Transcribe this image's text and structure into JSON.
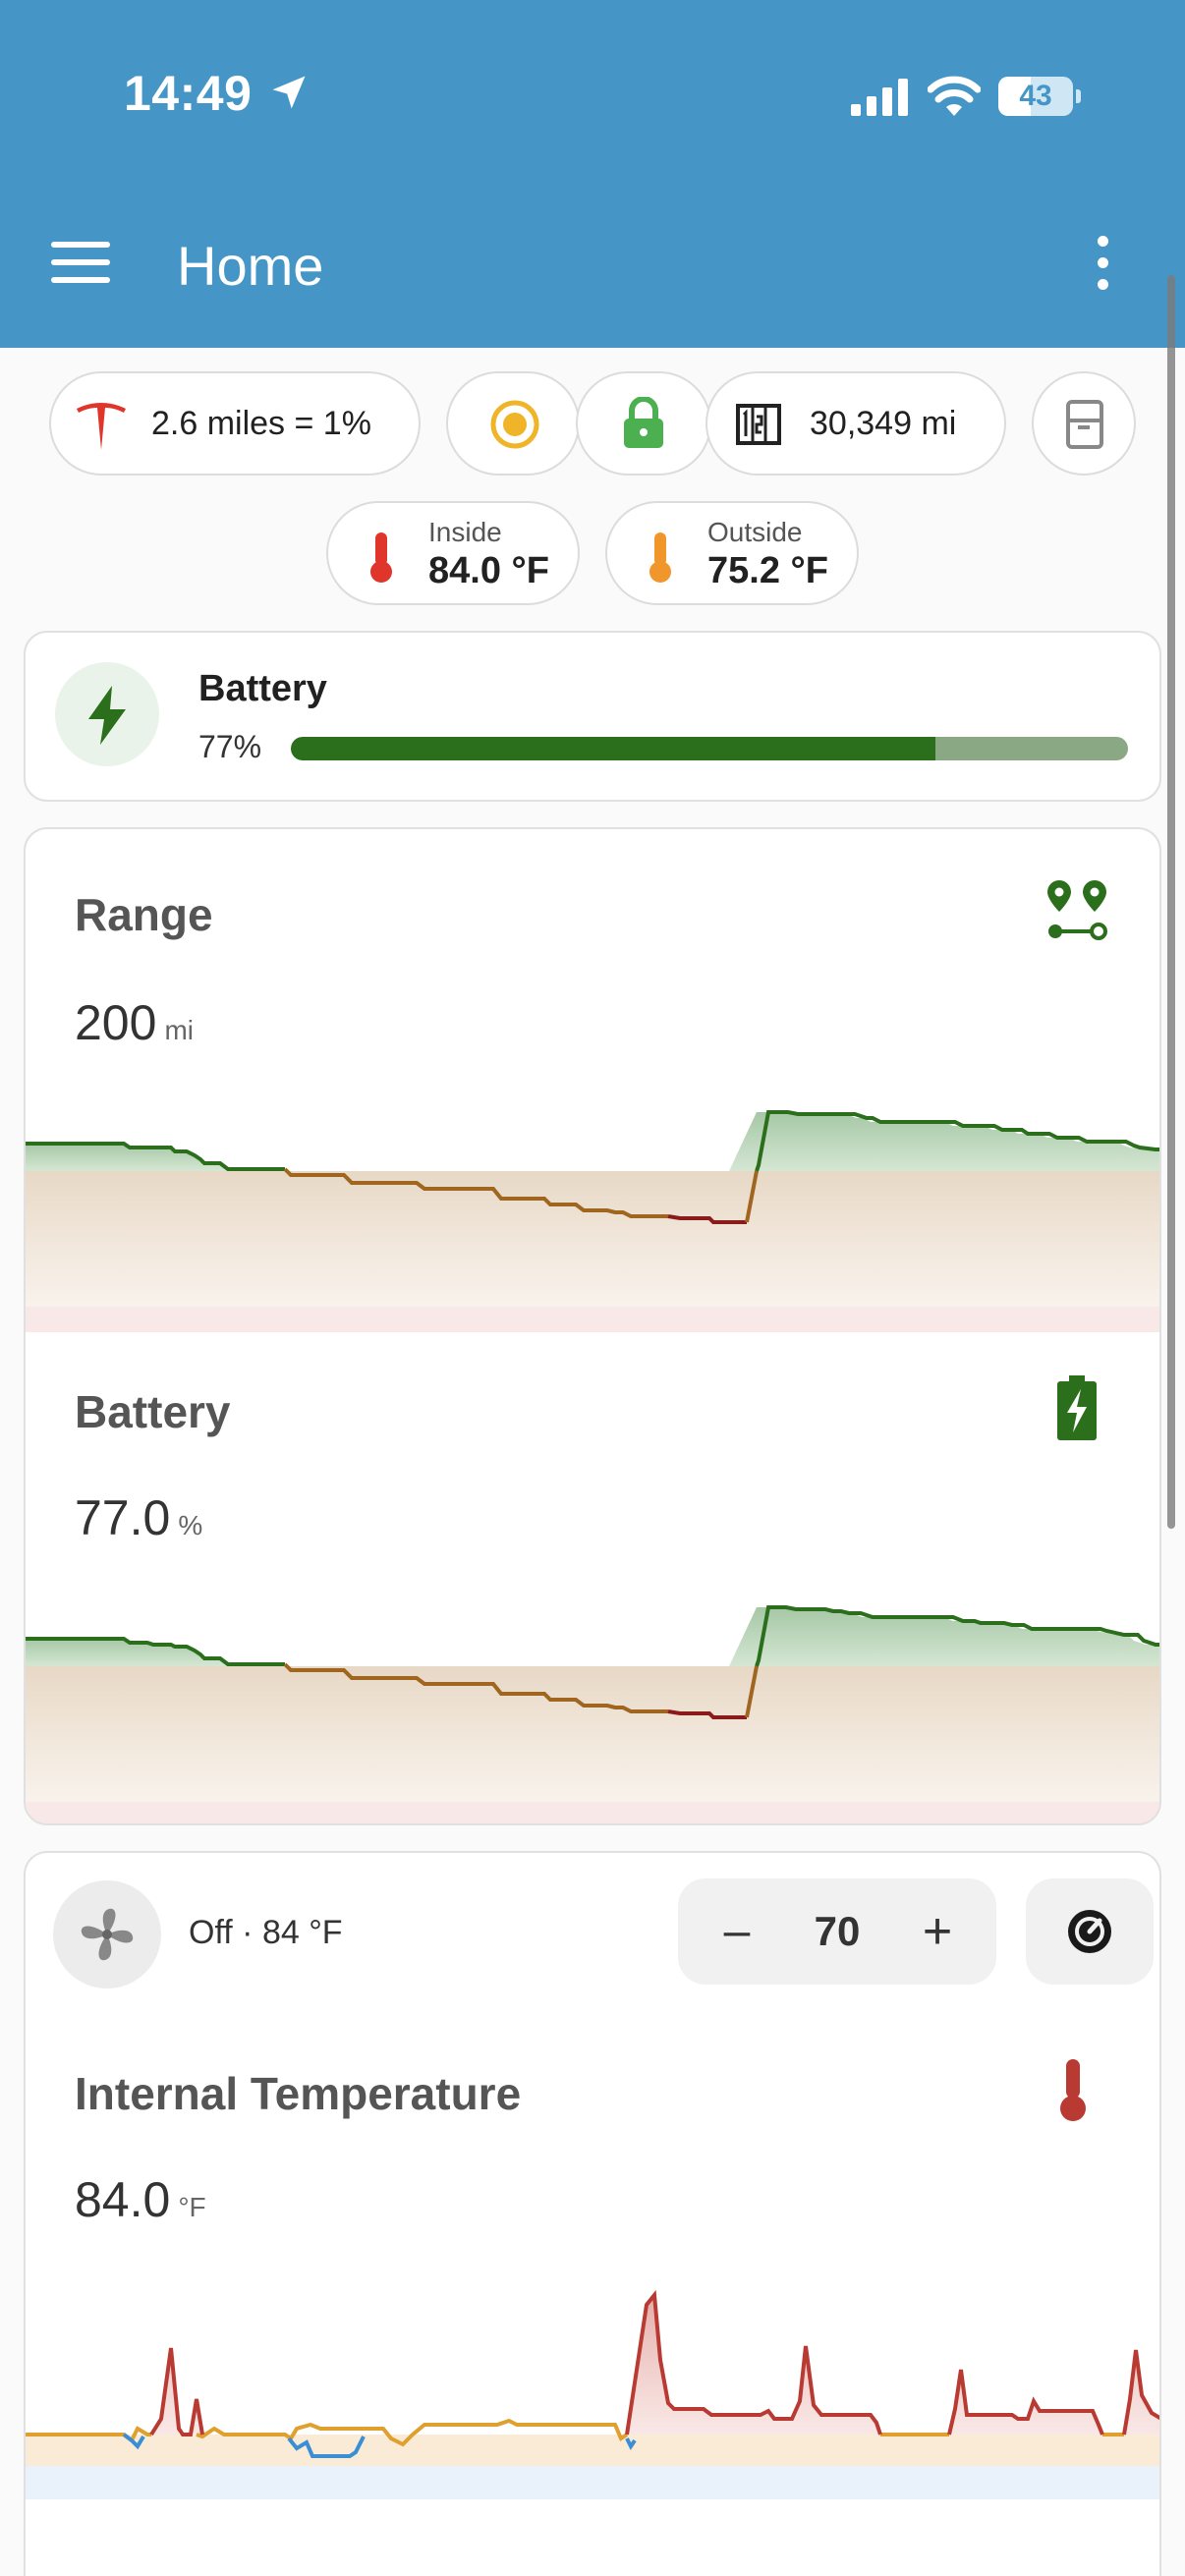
{
  "status_bar": {
    "time": "14:49",
    "battery_level": "43",
    "battery_fraction": 0.43
  },
  "header": {
    "title": "Home"
  },
  "chips": {
    "range_summary": "2.6 miles = 1%",
    "odometer": "30,349 mi"
  },
  "temps": {
    "inside_label": "Inside",
    "inside_value": "84.0 °F",
    "outside_label": "Outside",
    "outside_value": "75.2 °F"
  },
  "battery_tile": {
    "title": "Battery",
    "percent": "77%",
    "level_fraction": 0.77
  },
  "range_sensor": {
    "title": "Range",
    "value": "200",
    "unit": "mi"
  },
  "battery_sensor": {
    "title": "Battery",
    "value": "77.0",
    "unit": "%"
  },
  "climate": {
    "status": "Off · 84 °F",
    "target": "70",
    "minus": "–",
    "plus": "+"
  },
  "internal_temp_sensor": {
    "title": "Internal Temperature",
    "value": "84.0",
    "unit": "°F"
  },
  "icons": {
    "tesla": "tesla-logo-icon",
    "sentry": "sentry-icon",
    "lock": "lock-icon",
    "odometer": "odometer-icon",
    "frunk": "car-door-icon",
    "thermometer": "thermometer-icon",
    "bolt": "lightning-bolt-icon",
    "route": "route-icon",
    "battery_charging": "battery-charging-icon",
    "fan": "fan-icon",
    "hvac": "hvac-icon"
  },
  "colors": {
    "header": "#4596c6",
    "green": "#2b6f1c",
    "orange": "#a0651e",
    "red": "#8b1a1a",
    "temp_red": "#b83a32",
    "temp_orange": "#e0a030",
    "temp_blue": "#3a8fd4"
  }
}
